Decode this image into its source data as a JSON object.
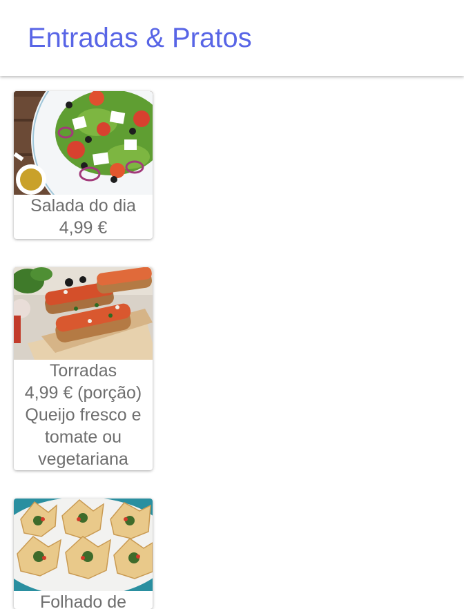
{
  "header": {
    "title": "Entradas & Pratos",
    "title_color": "#5865e6"
  },
  "menu_items": [
    {
      "image_icon": "greek-salad-photo",
      "name": "Salada do dia",
      "price": "4,99 €"
    },
    {
      "image_icon": "bruschetta-photo",
      "name": "Torradas",
      "price": "4,99 € (porção)",
      "description_line1": "Queijo fresco e",
      "description_line2": "tomate ou",
      "description_line3": "vegetariana"
    },
    {
      "image_icon": "puff-pastry-cups-photo",
      "name": "Folhado de"
    }
  ]
}
